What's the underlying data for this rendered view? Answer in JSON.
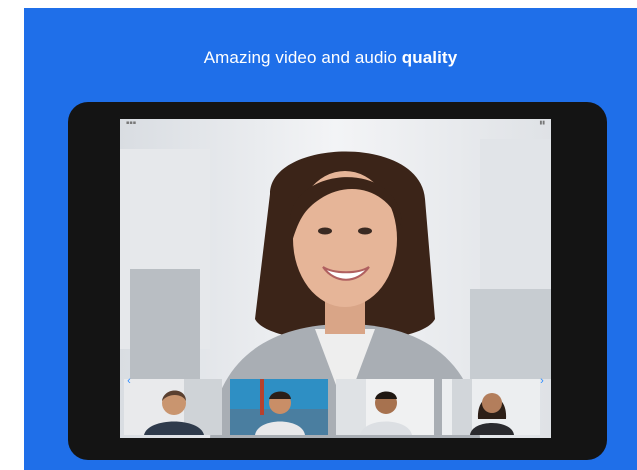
{
  "promo": {
    "headline_prefix": "Amazing video and audio",
    "headline_bold": "quality"
  },
  "colors": {
    "brand_blue": "#1f6fe9",
    "tablet_frame": "#141414",
    "accent_arrow": "#2d8cff"
  },
  "icons": {
    "strip_prev": "chevron-left-icon",
    "strip_next": "chevron-right-icon"
  },
  "participants": [
    {
      "name": "main-speaker"
    },
    {
      "name": "participant-1"
    },
    {
      "name": "participant-2"
    },
    {
      "name": "participant-3"
    },
    {
      "name": "participant-4"
    }
  ]
}
